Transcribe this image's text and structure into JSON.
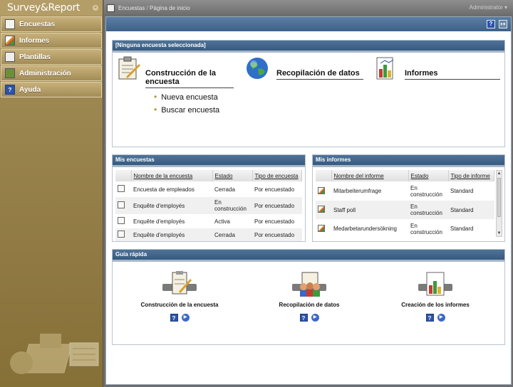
{
  "app": {
    "title": "Survey&Report"
  },
  "sidebar": {
    "items": [
      {
        "label": "Encuestas",
        "icon": "survey-icon"
      },
      {
        "label": "Informes",
        "icon": "report-chart-icon"
      },
      {
        "label": "Plantillas",
        "icon": "template-icon"
      },
      {
        "label": "Administración",
        "icon": "admin-icon"
      },
      {
        "label": "Ayuda",
        "icon": "help-icon"
      }
    ]
  },
  "topbar": {
    "crumb_root": "Encuestas",
    "crumb_sep": " / ",
    "crumb_current": "Página de inicio",
    "user": "Administrator"
  },
  "wizard": {
    "title": "[Ninguna encuesta seleccionada]",
    "build": {
      "title": "Construcción de la encuesta",
      "links": [
        "Nueva encuesta",
        "Buscar encuesta"
      ]
    },
    "collect": {
      "title": "Recopilación de datos"
    },
    "reports": {
      "title": "Informes"
    }
  },
  "my_surveys": {
    "title": "Mis encuestas",
    "columns": [
      "Nombre de la encuesta",
      "Estado",
      "Tipo de encuesta"
    ],
    "rows": [
      {
        "name": "Encuesta de empleados",
        "status": "Cerrada",
        "type": "Por encuestado"
      },
      {
        "name": "Enquête d'employés",
        "status": "En construcción",
        "type": "Por encuestado"
      },
      {
        "name": "Enquête d'employés",
        "status": "Activa",
        "type": "Por encuestado"
      },
      {
        "name": "Enquête d'employés",
        "status": "Cerrada",
        "type": "Por encuestado"
      }
    ]
  },
  "my_reports": {
    "title": "Mis informes",
    "columns": [
      "Nombre del informe",
      "Estado",
      "Tipo de informe"
    ],
    "rows": [
      {
        "name": "Mitarbeiterumfrage",
        "status": "En construcción",
        "type": "Standard"
      },
      {
        "name": "Staff poll",
        "status": "En construcción",
        "type": "Standard"
      },
      {
        "name": "Medarbetarundersökning",
        "status": "En construcción",
        "type": "Standard"
      }
    ]
  },
  "quick_guide": {
    "title": "Guía rápida",
    "items": [
      {
        "label": "Construcción de la encuesta"
      },
      {
        "label": "Recopilación de datos"
      },
      {
        "label": "Creación de los informes"
      }
    ]
  },
  "header_buttons": {
    "help": "?",
    "exit": "exit-icon"
  }
}
